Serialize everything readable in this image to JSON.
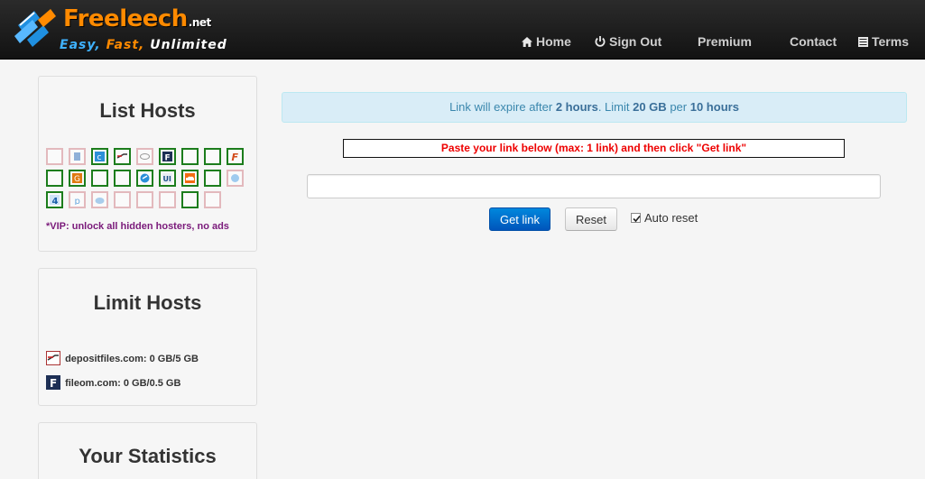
{
  "brand": {
    "name": "Freeleech",
    "tld": ".net",
    "tagline_1": "Easy,",
    "tagline_2": "Fast,",
    "tagline_3": "Unlimited"
  },
  "nav": {
    "home": "Home",
    "sign_out": "Sign Out",
    "premium": "Premium",
    "contact": "Contact",
    "terms": "Terms"
  },
  "sidebar": {
    "list_hosts_title": "List Hosts",
    "host_icons": [
      [
        "hidden-host",
        "hidden-host",
        "filehost-c",
        "depositfiles",
        "hidden-host",
        "fileom",
        "available-host",
        "available-host",
        "filehost-f"
      ],
      [
        "available-host",
        "filehost-g",
        "available-host",
        "available-host",
        "filehost-cloud",
        "uploaded",
        "soundcloud",
        "available-host",
        "hidden-host"
      ],
      [
        "filehost-4",
        "hidden-host",
        "hidden-host",
        "hidden-host",
        "hidden-host",
        "hidden-host",
        "available-host",
        "hidden-host"
      ]
    ],
    "vip_note": "*VIP: unlock all hidden hosters, no ads",
    "limit_hosts_title": "Limit Hosts",
    "limit_items": [
      {
        "label": "depositfiles.com:",
        "usage": "0 GB/5 GB"
      },
      {
        "label": "fileom.com:",
        "usage": "0 GB/0.5 GB"
      }
    ],
    "stats_title": "Your Statistics"
  },
  "main": {
    "expire_prefix": "Link will expire after",
    "expire_value": "2 hours",
    "limit_prefix": ". Limit",
    "limit_value": "20 GB",
    "per_word": "per",
    "per_value": "10 hours",
    "instructions": "Paste your link below (max: 1 link) and then click \"Get link\"",
    "link_input_value": "",
    "get_link_label": "Get link",
    "reset_label": "Reset",
    "auto_reset_label": "Auto reset",
    "auto_reset_checked": true
  },
  "colors": {
    "accent_orange": "#ff8a00",
    "accent_blue": "#3fb2ff",
    "instruction_red": "#ee0000",
    "vip_purple": "#7a1a7a",
    "info_bg": "#d9edf7",
    "primary_button": "#0066cc"
  }
}
